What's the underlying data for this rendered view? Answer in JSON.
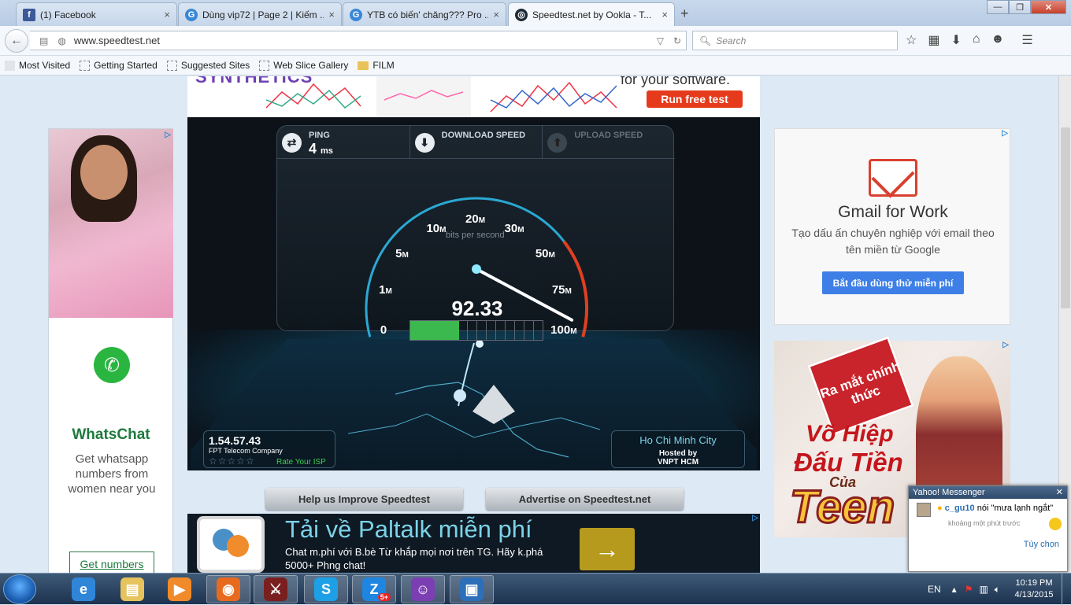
{
  "browser": {
    "tabs": [
      {
        "label": "(1) Facebook",
        "icon": "facebook-icon",
        "color": "#3b5998",
        "glyph": "f"
      },
      {
        "label": "Dùng vip72 | Page 2 | Kiếm ...",
        "icon": "loading-icon",
        "color": "#3a87d6",
        "glyph": "G"
      },
      {
        "label": "YTB có biến' chăng??? Pro ...",
        "icon": "loading-icon",
        "color": "#3a87d6",
        "glyph": "G"
      },
      {
        "label": "Speedtest.net by Ookla - T...",
        "icon": "speedtest-icon",
        "color": "#1d2b38",
        "glyph": "◎"
      }
    ],
    "close_tab": "×",
    "new_tab": "+",
    "window": {
      "minimize": "—",
      "maximize": "❐",
      "close": "✕"
    },
    "url": "www.speedtest.net",
    "search_placeholder": "Search",
    "bookmarks": [
      "Most Visited",
      "Getting Started",
      "Suggested Sites",
      "Web Slice Gallery",
      "FILM"
    ]
  },
  "top_ad": {
    "brand": "SYNTHETICS",
    "tagline": "for your software.",
    "cta": "Run free test"
  },
  "left_ad": {
    "adchoices": "▷",
    "title": "WhatsChat",
    "text": "Get whatsapp numbers from women near you",
    "cta": "Get numbers"
  },
  "speedtest": {
    "ping_label": "PING",
    "ping_value": "4",
    "ping_unit": "ms",
    "download_label": "DOWNLOAD SPEED",
    "upload_label": "UPLOAD SPEED",
    "units_label": "bits per second",
    "speed": "92.33",
    "speed_numeric": 92.33,
    "gauge_labels": [
      {
        "value": "0",
        "unit": ""
      },
      {
        "value": "1",
        "unit": "M"
      },
      {
        "value": "5",
        "unit": "M"
      },
      {
        "value": "10",
        "unit": "M"
      },
      {
        "value": "20",
        "unit": "M"
      },
      {
        "value": "30",
        "unit": "M"
      },
      {
        "value": "50",
        "unit": "M"
      },
      {
        "value": "75",
        "unit": "M"
      },
      {
        "value": "100",
        "unit": "M"
      }
    ],
    "isp_ip": "1.54.57.43",
    "isp_name": "FPT Telecom Company",
    "rate_isp": "Rate Your ISP",
    "stars": "☆☆☆☆☆",
    "server_city": "Ho Chi Minh City",
    "hosted_by": "Hosted by",
    "host_name": "VNPT HCM",
    "colors": {
      "arc_blue": "#2aa9d4",
      "arc_red": "#e04020",
      "needle": "#ffffff",
      "progress": "#3bb94e"
    }
  },
  "links": {
    "improve": "Help us Improve Speedtest",
    "advertise": "Advertise on Speedtest.net"
  },
  "paltalk_ad": {
    "title": "Tải về Paltalk miễn phí",
    "text": "Chat m.phí với B.bè Từ khắp mọi nơi trên TG. Hãy k.phá 5000+ Phng chat!",
    "cta": "→"
  },
  "gmail_ad": {
    "title": "Gmail for Work",
    "text": "Tạo dấu ấn chuyên nghiệp với email theo tên miền từ Google",
    "cta": "Bắt đầu dùng thử miễn phí"
  },
  "game_ad": {
    "badge": "Ra mắt chính thức",
    "line1": "Võ Hiệp",
    "line2": "Đấu Tiền",
    "line3": "Của",
    "line4": "Teen"
  },
  "yahoo": {
    "title": "Yahoo! Messenger",
    "user": "c_gu10",
    "message": "nói \"mưa lạnh ngắt\"",
    "time": "khoảng một phút trước",
    "action": "Tùy chọn"
  },
  "taskbar": {
    "apps": [
      {
        "name": "internet-explorer",
        "glyph": "e",
        "color": "#2f86d8"
      },
      {
        "name": "file-explorer",
        "glyph": "▤",
        "color": "#e6c35c"
      },
      {
        "name": "media-player",
        "glyph": "▶",
        "color": "#f08a2a"
      },
      {
        "name": "firefox",
        "glyph": "◉",
        "color": "#e86a1e"
      },
      {
        "name": "game-app",
        "glyph": "⚔",
        "color": "#7a1f1f"
      },
      {
        "name": "skype",
        "glyph": "S",
        "color": "#1ea0e6"
      },
      {
        "name": "zalo",
        "glyph": "Z",
        "color": "#1e86e0"
      },
      {
        "name": "yahoo-messenger",
        "glyph": "☺",
        "color": "#7b3fb3"
      },
      {
        "name": "virtualbox",
        "glyph": "▣",
        "color": "#2d6fb8"
      }
    ],
    "zalo_badge": "5+",
    "language": "EN",
    "time": "10:19 PM",
    "date": "4/13/2015"
  }
}
